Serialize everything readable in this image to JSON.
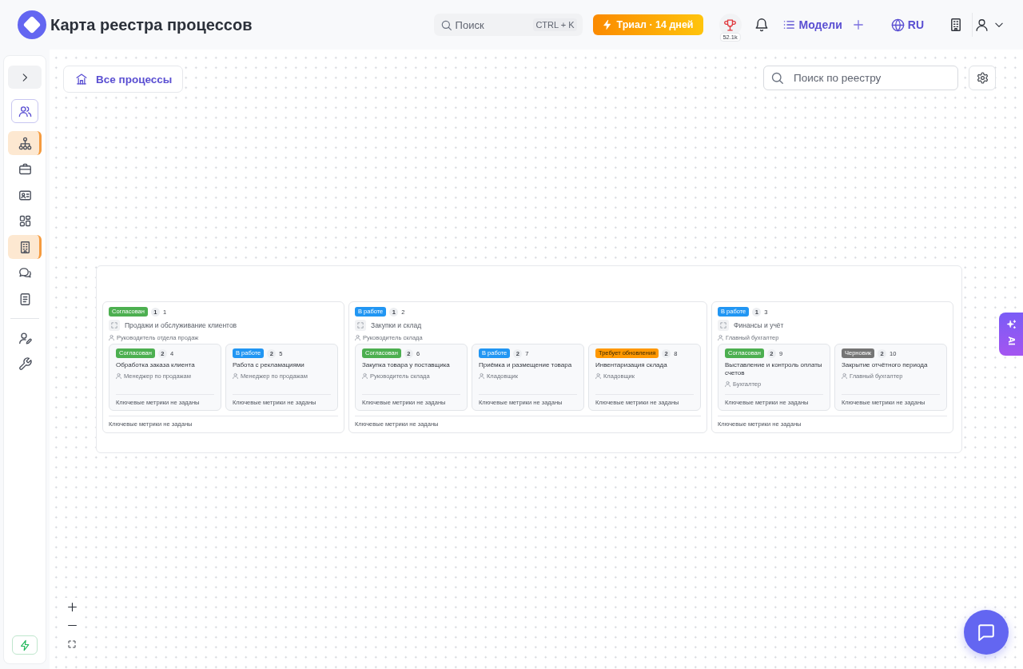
{
  "header": {
    "title": "Карта реестра процессов",
    "search": {
      "placeholder": "Поиск",
      "shortcut": "CTRL + K"
    },
    "trial_button": "Триал · 14 дней",
    "trophy_count": "52.1k",
    "models_button": "Модели",
    "language": "RU"
  },
  "sidebar": {
    "team_button": {
      "selected": true
    },
    "items": [
      {
        "selected": true
      },
      {
        "selected": false
      },
      {
        "selected": false
      },
      {
        "selected": false
      },
      {
        "selected": true
      },
      {
        "selected": false
      },
      {
        "selected": false
      }
    ],
    "tools": [
      {
        "selected": false
      },
      {
        "selected": false
      }
    ]
  },
  "toolbar": {
    "all_processes_button": "Все процессы",
    "registry_search": {
      "placeholder": "Поиск по реестру"
    }
  },
  "groups": [
    {
      "status": {
        "label": "Согласован",
        "color": "#4caf50"
      },
      "badge": "1",
      "number": "1",
      "title": "Продажи и обслуживание клиентов",
      "owner": "Руководитель отдела продаж",
      "children": [
        {
          "status": {
            "label": "Согласован",
            "color": "#4caf50"
          },
          "badge": "2",
          "number": "4",
          "title": "Обработка заказа клиента",
          "owner": "Менеджер по продажам",
          "metrics": "Ключевые метрики не заданы"
        },
        {
          "status": {
            "label": "В работе",
            "color": "#2196f3"
          },
          "badge": "2",
          "number": "5",
          "title": "Работа с рекламациями",
          "owner": "Менеджер по продажам",
          "metrics": "Ключевые метрики не заданы"
        }
      ],
      "metrics": "Ключевые метрики не заданы"
    },
    {
      "status": {
        "label": "В работе",
        "color": "#2196f3"
      },
      "badge": "1",
      "number": "2",
      "title": "Закупки и склад",
      "owner": "Руководитель склада",
      "children": [
        {
          "status": {
            "label": "Согласован",
            "color": "#4caf50"
          },
          "badge": "2",
          "number": "6",
          "title": "Закупка товара у поставщика",
          "owner": "Руководитель склада",
          "metrics": "Ключевые метрики не заданы"
        },
        {
          "status": {
            "label": "В работе",
            "color": "#2196f3"
          },
          "badge": "2",
          "number": "7",
          "title": "Приёмка и размещение товара",
          "owner": "Кладовщик",
          "metrics": "Ключевые метрики не заданы"
        },
        {
          "status": {
            "label": "Требует обновления",
            "color": "#ff9800"
          },
          "badge": "2",
          "number": "8",
          "title": "Инвентаризация склада",
          "owner": "Кладовщик",
          "metrics": "Ключевые метрики не заданы"
        }
      ],
      "metrics": "Ключевые метрики не заданы"
    },
    {
      "status": {
        "label": "В работе",
        "color": "#2196f3"
      },
      "badge": "1",
      "number": "3",
      "title": "Финансы и учёт",
      "owner": "Главный бухгалтер",
      "children": [
        {
          "status": {
            "label": "Согласован",
            "color": "#4caf50"
          },
          "badge": "2",
          "number": "9",
          "title": "Выставление и контроль оплаты счетов",
          "owner": "Бухгалтер",
          "metrics": "Ключевые метрики не заданы"
        },
        {
          "status": {
            "label": "Черновик",
            "color": "#757575"
          },
          "badge": "2",
          "number": "10",
          "title": "Закрытие отчётного периода",
          "owner": "Главный бухгалтер",
          "metrics": "Ключевые метрики не заданы"
        }
      ],
      "metrics": "Ключевые метрики не заданы"
    }
  ],
  "ai_tab": {
    "label": "AI"
  }
}
